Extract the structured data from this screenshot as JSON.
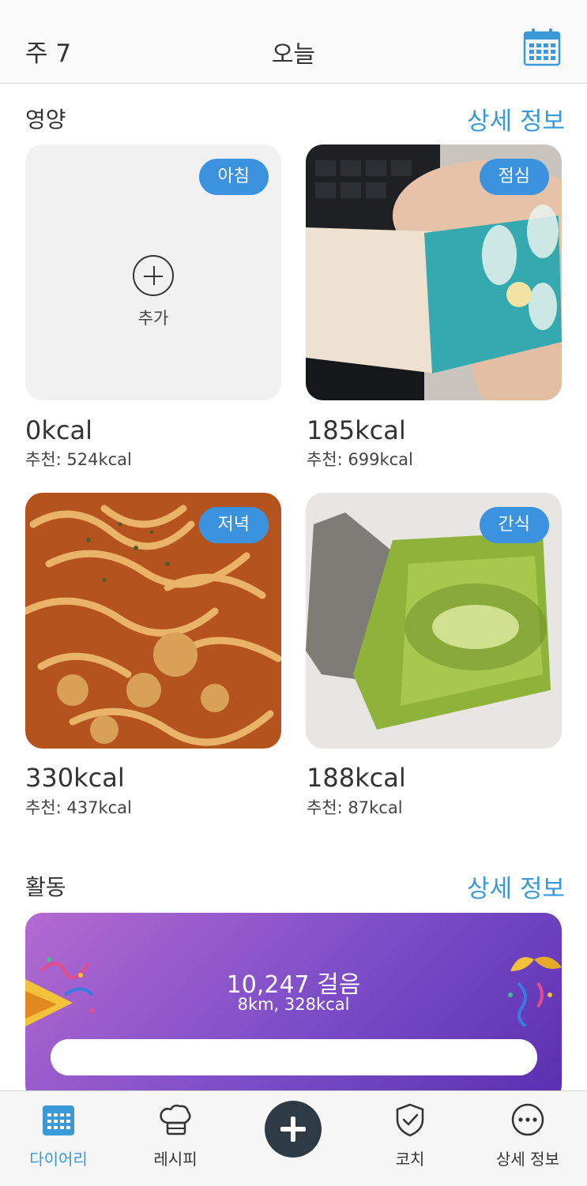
{
  "header": {
    "week": "주 7",
    "title": "오늘",
    "calendar_icon": "calendar-icon"
  },
  "nutrition": {
    "title": "영양",
    "more": "상세 정보",
    "meals": [
      {
        "tag": "아침",
        "kcal": "0kcal",
        "recommended": "추천: 524kcal",
        "add_label": "추가",
        "photo": "none"
      },
      {
        "tag": "점심",
        "kcal": "185kcal",
        "recommended": "추천: 699kcal",
        "photo": "berry-nuts-bar-photo"
      },
      {
        "tag": "저녁",
        "kcal": "330kcal",
        "recommended": "추천: 437kcal",
        "photo": "tteokbokki-pasta-photo"
      },
      {
        "tag": "간식",
        "kcal": "188kcal",
        "recommended": "추천: 87kcal",
        "photo": "konjac-snack-photo"
      }
    ]
  },
  "activity": {
    "title": "활동",
    "more": "상세 정보",
    "steps": "10,247 걸음",
    "detail": "8km, 328kcal",
    "progress_fraction": 1.0,
    "left_icon": "party-popper-icon",
    "right_icon": "bells-confetti-icon"
  },
  "tabbar": {
    "items": [
      {
        "label": "다이어리",
        "icon": "calendar-icon",
        "active": true
      },
      {
        "label": "레시피",
        "icon": "chef-hat-icon",
        "active": false
      },
      {
        "label": "",
        "icon": "plus-icon",
        "active": false
      },
      {
        "label": "코치",
        "icon": "shield-check-icon",
        "active": false
      },
      {
        "label": "상세 정보",
        "icon": "more-icon",
        "active": false
      }
    ]
  },
  "colors": {
    "accent": "#3a9ad9",
    "tag": "#3b93e0",
    "fab": "#2f3b44",
    "activity_start": "#b46ad0",
    "activity_end": "#5a2fb0"
  }
}
